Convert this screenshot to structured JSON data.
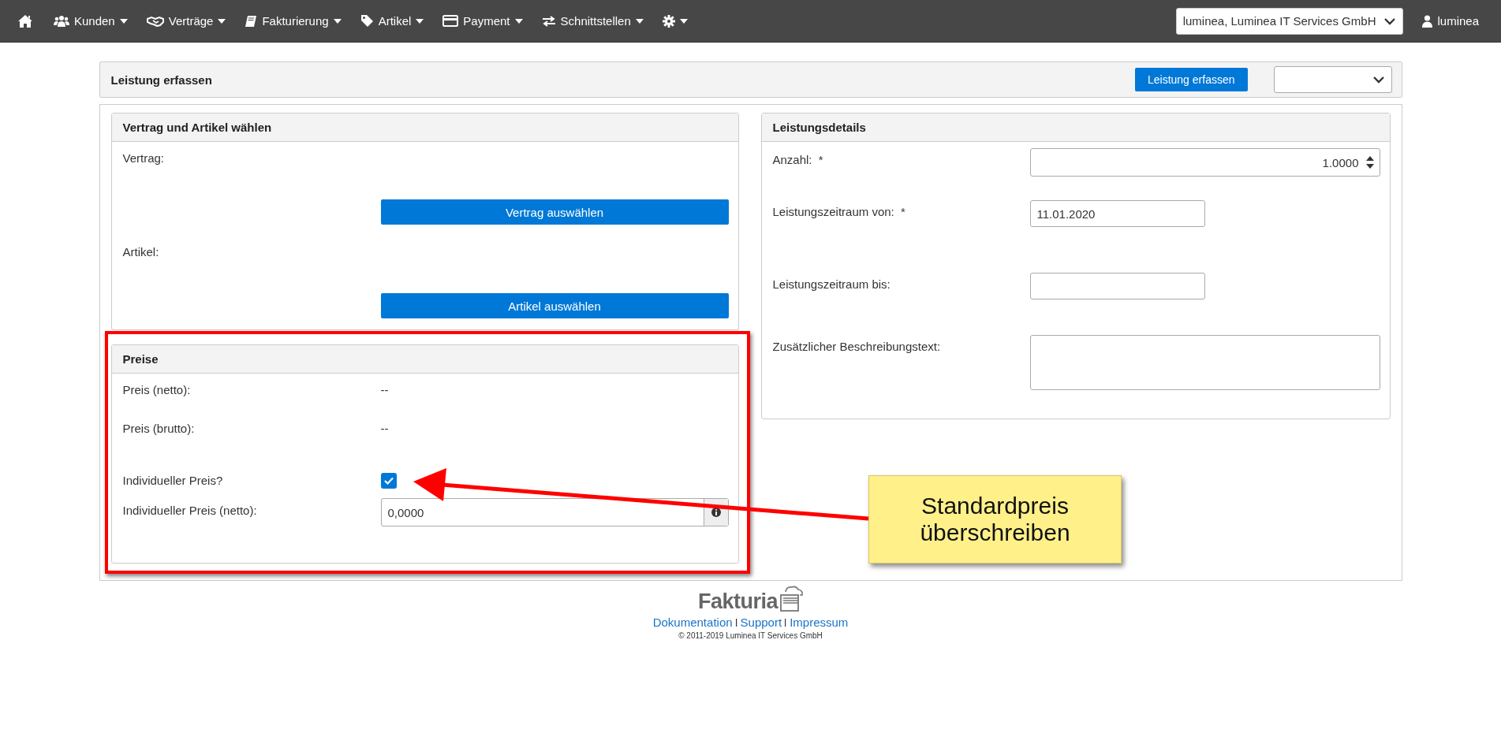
{
  "navbar": {
    "items": [
      {
        "dropdown": false
      },
      {
        "label": "Kunden",
        "dropdown": true
      },
      {
        "label": "Verträge",
        "dropdown": true
      },
      {
        "label": "Fakturierung",
        "dropdown": true
      },
      {
        "label": "Artikel",
        "dropdown": true
      },
      {
        "label": "Payment",
        "dropdown": true
      },
      {
        "label": "Schnittstellen",
        "dropdown": true
      },
      {
        "dropdown": true
      }
    ],
    "company_select": "luminea, Luminea IT Services GmbH",
    "user": "luminea"
  },
  "header": {
    "title": "Leistung erfassen",
    "button": "Leistung erfassen"
  },
  "selection": {
    "title": "Vertrag und Artikel wählen",
    "rows": [
      {
        "label": "Vertrag:",
        "button": "Vertrag auswählen"
      },
      {
        "label": "Artikel:",
        "button": "Artikel auswählen"
      }
    ]
  },
  "prices": {
    "title": "Preise",
    "rows": [
      {
        "kind": "text",
        "label": "Preis (netto):",
        "value": "--"
      },
      {
        "kind": "text",
        "label": "Preis (brutto):",
        "value": "--"
      },
      {
        "kind": "checkbox",
        "label": "Individueller Preis?",
        "checked": true
      },
      {
        "kind": "input",
        "label": "Individueller Preis (netto):",
        "value": "0,0000"
      }
    ]
  },
  "details": {
    "title": "Leistungsdetails",
    "rows": [
      {
        "kind": "number",
        "label": "Anzahl:  *",
        "value": "1.0000"
      },
      {
        "kind": "date",
        "label": "Leistungszeitraum von:  *",
        "value": "11.01.2020"
      },
      {
        "kind": "date",
        "label": "Leistungszeitraum bis:",
        "value": ""
      },
      {
        "kind": "textarea",
        "label": "Zusätzlicher Beschreibungstext:",
        "value": ""
      }
    ]
  },
  "footer": {
    "logo": "Fakturia",
    "links": [
      "Dokumentation",
      "Support",
      "Impressum"
    ],
    "copyright": "© 2011-2019 Luminea IT Services GmbH"
  },
  "callout": {
    "text": "Standardpreis überschreiben"
  }
}
